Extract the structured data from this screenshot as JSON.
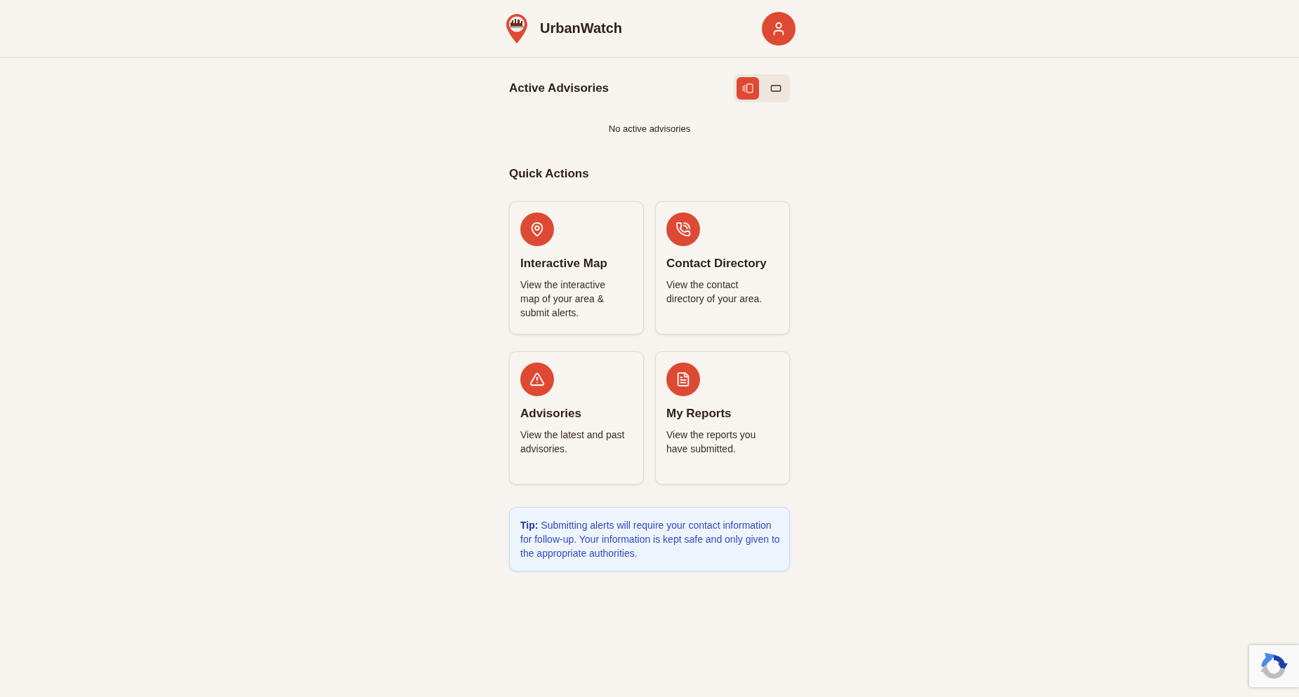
{
  "header": {
    "app_name": "UrbanWatch"
  },
  "advisories": {
    "title": "Active Advisories",
    "view_toggle": [
      {
        "kind": "carousel",
        "selected": true
      },
      {
        "kind": "single",
        "selected": false
      }
    ],
    "empty_message": "No active advisories"
  },
  "quick_actions": {
    "title": "Quick Actions",
    "cards": [
      {
        "kind": "map",
        "title": "Interactive Map",
        "description": "View the interactive map of your area & submit alerts."
      },
      {
        "kind": "phone",
        "title": "Contact Directory",
        "description": "View the contact directory of your area."
      },
      {
        "kind": "warning",
        "title": "Advisories",
        "description": "View the latest and past advisories."
      },
      {
        "kind": "document",
        "title": "My Reports",
        "description": "View the reports you have submitted."
      }
    ]
  },
  "tip": {
    "text": "**Tip:** Submitting alerts will require your contact information for follow-up. Your information is kept safe and only given to the appropriate authorities."
  }
}
